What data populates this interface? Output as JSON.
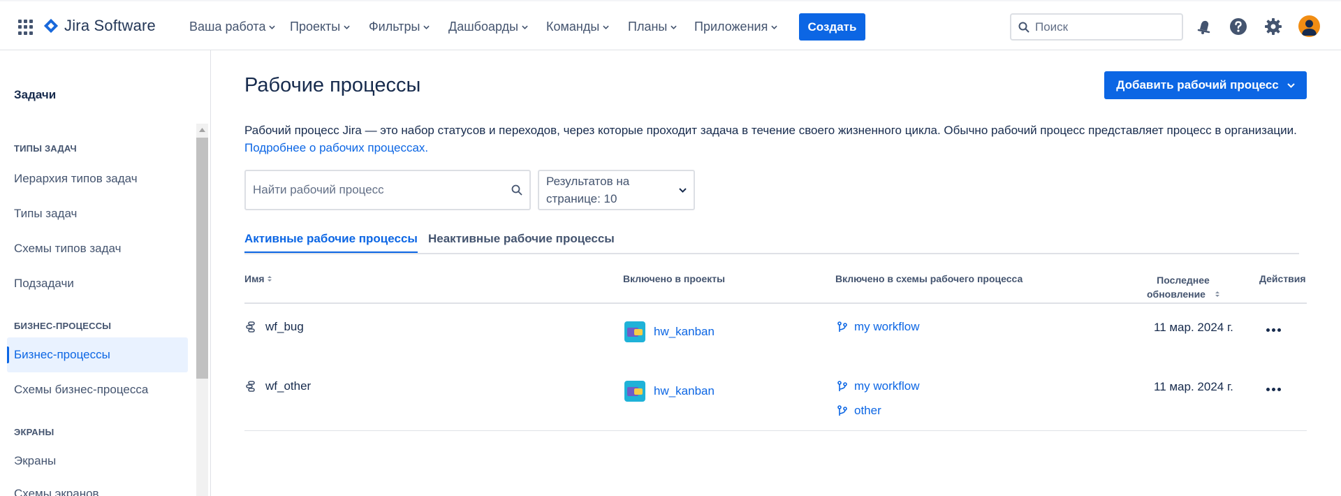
{
  "app": {
    "name": "Jira Software"
  },
  "nav": {
    "items": [
      "Ваша работа",
      "Проекты",
      "Фильтры",
      "Дашбоарды",
      "Команды",
      "Планы",
      "Приложения"
    ],
    "create": "Создать",
    "search_placeholder": "Поиск"
  },
  "sidebar": {
    "title": "Задачи",
    "sections": [
      {
        "label": "ТИПЫ ЗАДАЧ",
        "items": [
          "Иерархия типов задач",
          "Типы задач",
          "Схемы типов задач",
          "Подзадачи"
        ]
      },
      {
        "label": "БИЗНЕС-ПРОЦЕССЫ",
        "items": [
          "Бизнес-процессы",
          "Схемы бизнес-процесса"
        ]
      },
      {
        "label": "ЭКРАНЫ",
        "items": [
          "Экраны",
          "Схемы экранов"
        ]
      }
    ],
    "active_item": "Бизнес-процессы"
  },
  "main": {
    "title": "Рабочие процессы",
    "add_button": "Добавить рабочий процесс",
    "description": "Рабочий процесс Jira — это набор статусов и переходов, через которые проходит задача в течение своего жизненного цикла. Обычно рабочий процесс представляет процесс в организации.",
    "description_link": "Подробнее о рабочих процессах.",
    "search_placeholder": "Найти рабочий процесс",
    "per_page": "Результатов на странице: 10",
    "tabs": [
      "Активные рабочие процессы",
      "Неактивные рабочие процессы"
    ],
    "active_tab": 0
  },
  "table": {
    "headers": {
      "name": "Имя",
      "projects": "Включено в проекты",
      "schemes": "Включено в схемы рабочего процесса",
      "updated_line1": "Последнее",
      "updated_line2": "обновление",
      "actions": "Действия"
    },
    "rows": [
      {
        "name": "wf_bug",
        "project": "hw_kanban",
        "schemes": [
          "my workflow"
        ],
        "updated": "11 мар. 2024 г."
      },
      {
        "name": "wf_other",
        "project": "hw_kanban",
        "schemes": [
          "my workflow",
          "other"
        ],
        "updated": "11 мар. 2024 г."
      }
    ]
  },
  "colors": {
    "primary": "#0c66e4",
    "text": "#172b4d",
    "subtle": "#44546f",
    "active_bg": "#e9f2ff"
  }
}
